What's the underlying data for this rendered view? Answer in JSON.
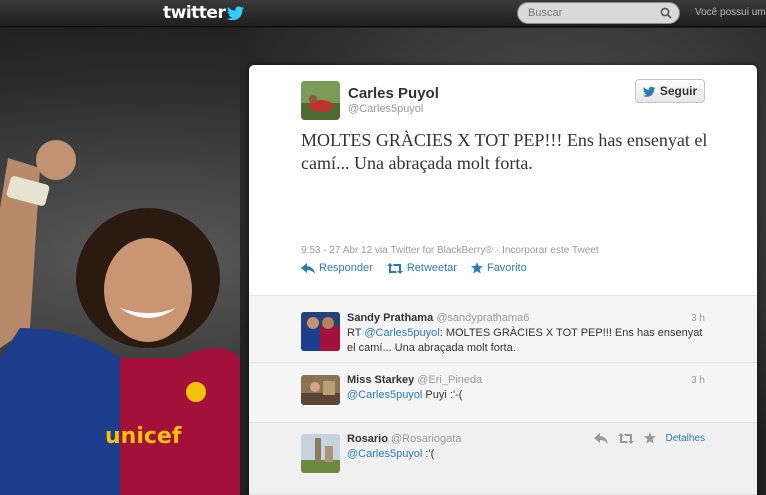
{
  "topbar": {
    "logo_text": "twitter",
    "search_placeholder": "Buscar",
    "account_text": "Você possui uma"
  },
  "tweet": {
    "name": "Carles Puyol",
    "handle": "@Carles5puyol",
    "follow_label": "Seguir",
    "text": "MOLTES GRÀCIES X TOT PEP!!! Ens has ensenyat el camí... Una abraçada molt forta.",
    "meta_time": "9:53 - 27 Abr 12 via Twitter for BlackBerry®",
    "meta_embed": "Incorporar este Tweet",
    "actions": {
      "reply": "Responder",
      "retweet": "Retweetar",
      "favorite": "Favorito"
    }
  },
  "replies": [
    {
      "name": "Sandy Prathama",
      "handle": "@sandyprathama6",
      "time": "3 h",
      "mention": "@Carles5puyol",
      "prefix": "RT ",
      "text": ": MOLTES GRÀCIES X TOT PEP!!! Ens has ensenyat el camí... Una abraçada molt forta."
    },
    {
      "name": "Miss Starkey",
      "handle": "@Eri_Pineda",
      "time": "3 h",
      "mention": "@Carles5puyol",
      "prefix": "",
      "text": " Puyi :'-("
    },
    {
      "name": "Rosario",
      "handle": "@Rosariogata",
      "time": "",
      "mention": "@Carles5puyol",
      "prefix": "",
      "text": " :'(",
      "details_label": "Detalhes"
    }
  ],
  "colors": {
    "link": "#2b7bb9",
    "topbar": "#2a2a2a",
    "twitter_bird": "#33ccff",
    "barca_blue": "#1c3e8c",
    "barca_red": "#a3103a"
  }
}
